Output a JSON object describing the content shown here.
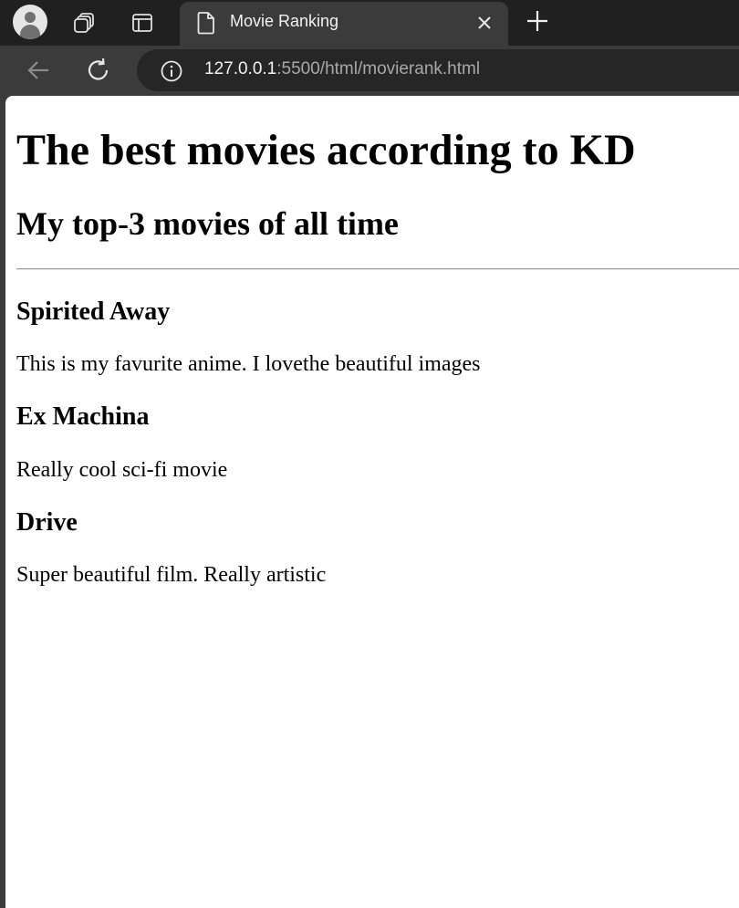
{
  "browser": {
    "tab": {
      "title": "Movie Ranking"
    },
    "address_bar": {
      "url_host": "127.0.0.1",
      "url_rest": ":5500/html/movierank.html"
    }
  },
  "page": {
    "heading": "The best movies according to KD",
    "subheading": "My top-3 movies of all time",
    "movies": [
      {
        "title": "Spirited Away",
        "description": "This is my favurite anime. I lovethe beautiful images"
      },
      {
        "title": "Ex Machina",
        "description": "Really cool sci-fi movie"
      },
      {
        "title": "Drive",
        "description": "Super beautiful film. Really artistic"
      }
    ]
  },
  "colors": {
    "tabbar_bg": "#202020",
    "toolbar_bg": "#3b3b3b",
    "omnibox_bg": "#262626",
    "page_bg": "#ffffff"
  }
}
